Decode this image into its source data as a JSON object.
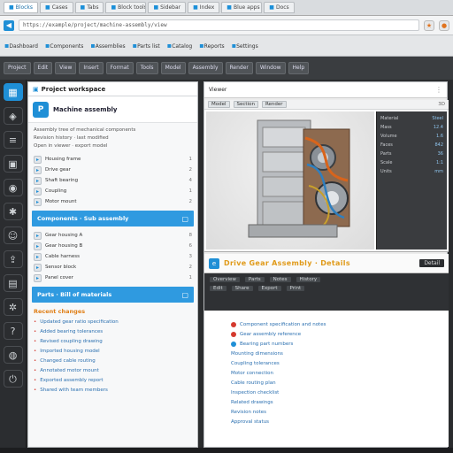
{
  "tabs": [
    {
      "label": "Blocks"
    },
    {
      "label": "Cases"
    },
    {
      "label": "Tabs"
    },
    {
      "label": "Block tools"
    },
    {
      "label": "Sidebar"
    },
    {
      "label": "Index"
    },
    {
      "label": "Blue apps"
    },
    {
      "label": "Docs"
    }
  ],
  "address": {
    "url": "https://example/project/machine-assembly/view",
    "nav_glyph": "◀"
  },
  "bookmarks": [
    "Dashboard",
    "Components",
    "Assemblies",
    "Parts list",
    "Catalog",
    "Reports",
    "Settings"
  ],
  "toolbar": [
    "Project",
    "Edit",
    "View",
    "Insert",
    "Format",
    "Tools",
    "Model",
    "Assembly",
    "Render",
    "Window",
    "Help"
  ],
  "rail_icons": [
    "grid-icon",
    "cube-icon",
    "layers-icon",
    "folder-icon",
    "camera-icon",
    "settings-icon",
    "users-icon",
    "share-icon",
    "chart-icon",
    "gear-icon",
    "help-icon",
    "user-icon",
    "logout-icon"
  ],
  "left": {
    "title": "Project workspace",
    "project_logo": "P",
    "project_name": "Machine assembly",
    "blurbs": [
      "Assembly tree of mechanical components",
      "Revision history · last modified",
      "Open in viewer · export model"
    ],
    "section1": [
      {
        "label": "Housing frame",
        "value": "1"
      },
      {
        "label": "Drive gear",
        "value": "2"
      },
      {
        "label": "Shaft bearing",
        "value": "4"
      },
      {
        "label": "Coupling",
        "value": "1"
      },
      {
        "label": "Motor mount",
        "value": "2"
      }
    ],
    "bluebar1": "Components  ·  Sub assembly",
    "section2": [
      {
        "label": "Gear housing A",
        "value": "8"
      },
      {
        "label": "Gear housing B",
        "value": "6"
      },
      {
        "label": "Cable harness",
        "value": "3"
      },
      {
        "label": "Sensor block",
        "value": "2"
      },
      {
        "label": "Panel cover",
        "value": "1"
      }
    ],
    "bluebar2": "Parts  ·  Bill of materials",
    "orange_tag": "Recent changes",
    "links": [
      "Updated gear ratio specification",
      "Added bearing tolerances",
      "Revised coupling drawing",
      "Imported housing model",
      "Changed cable routing",
      "Annotated motor mount",
      "Exported assembly report",
      "Shared with team members"
    ]
  },
  "right": {
    "header_label": "Viewer",
    "viewer_tabs": [
      "Model",
      "Section",
      "Render"
    ],
    "viewer_status": "3D",
    "props": [
      {
        "k": "Material",
        "v": "Steel"
      },
      {
        "k": "Mass",
        "v": "12.4"
      },
      {
        "k": "Volume",
        "v": "1.6"
      },
      {
        "k": "Faces",
        "v": "842"
      },
      {
        "k": "Parts",
        "v": "36"
      },
      {
        "k": "Scale",
        "v": "1:1"
      },
      {
        "k": "Units",
        "v": "mm"
      }
    ],
    "tab_logo": "e",
    "tab_title": "Drive Gear Assembly · Details",
    "tab_badge": "Detail",
    "dark_rows": [
      [
        "Overview",
        "Parts",
        "Notes",
        "History"
      ],
      [
        "Edit",
        "Share",
        "Export",
        "Print"
      ]
    ],
    "doc_lines": [
      {
        "text": "Component specification and notes",
        "dot": "red"
      },
      {
        "text": "Gear assembly reference",
        "dot": "red"
      },
      {
        "text": "Bearing part numbers",
        "dot": "blue"
      },
      {
        "text": "Mounting dimensions",
        "dot": ""
      },
      {
        "text": "Coupling tolerances",
        "dot": ""
      },
      {
        "text": "Motor connection",
        "dot": ""
      },
      {
        "text": "Cable routing plan",
        "dot": ""
      },
      {
        "text": "Inspection checklist",
        "dot": ""
      },
      {
        "text": "Related drawings",
        "dot": ""
      },
      {
        "text": "Revision notes",
        "dot": ""
      },
      {
        "text": "Approval status",
        "dot": ""
      }
    ]
  }
}
